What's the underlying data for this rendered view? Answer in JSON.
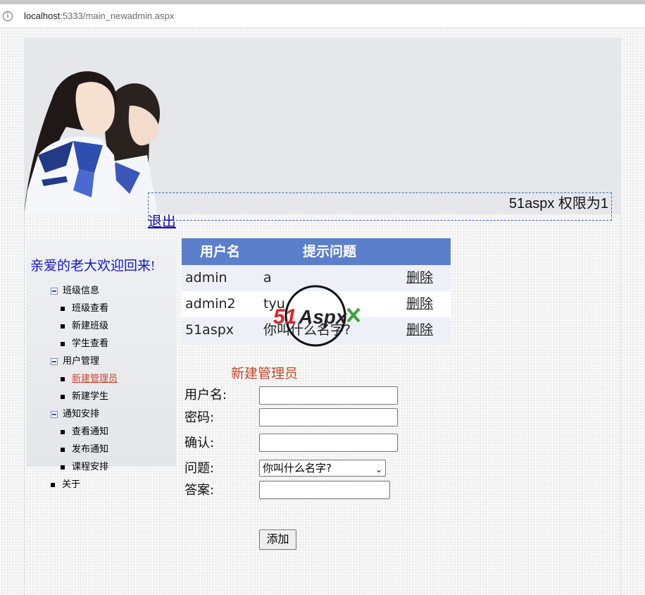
{
  "browser": {
    "url_host": "localhost",
    "url_path": ":5333/main_newadmin.aspx"
  },
  "header": {
    "user_info": "51aspx 权限为1",
    "logout_label": "退出"
  },
  "sidebar": {
    "welcome": "亲爱的老大欢迎回来!",
    "groups": [
      {
        "label": "班级信息",
        "items": [
          "班级查看",
          "新建班级",
          "学生查看"
        ]
      },
      {
        "label": "用户管理",
        "items": [
          "新建管理员",
          "新建学生"
        ]
      },
      {
        "label": "通知安排",
        "items": [
          "查看通知",
          "发布通知",
          "课程安排"
        ]
      }
    ],
    "about": "关于",
    "current_item": "新建管理员"
  },
  "table": {
    "headers": [
      "用户名",
      "提示问题",
      ""
    ],
    "rows": [
      {
        "username": "admin",
        "question": "a",
        "action": "删除"
      },
      {
        "username": "admin2",
        "question": "tyu",
        "action": "删除"
      },
      {
        "username": "51aspx",
        "question": "你叫什么名字?",
        "action": "删除"
      }
    ]
  },
  "form": {
    "title": "新建管理员",
    "username_label": "用户名:",
    "password_label": "密码:",
    "confirm_label": "确认:",
    "question_label": "问题:",
    "answer_label": "答案:",
    "question_selected": "你叫什么名字?",
    "submit_label": "添加",
    "username_value": "",
    "password_value": "",
    "confirm_value": "",
    "answer_value": ""
  },
  "watermark": {
    "text": "51Aspx"
  },
  "colors": {
    "table_header": "#5b7fcb",
    "welcome_text": "#1515c8",
    "form_title": "#c0492a",
    "link": "#1a0dab"
  }
}
